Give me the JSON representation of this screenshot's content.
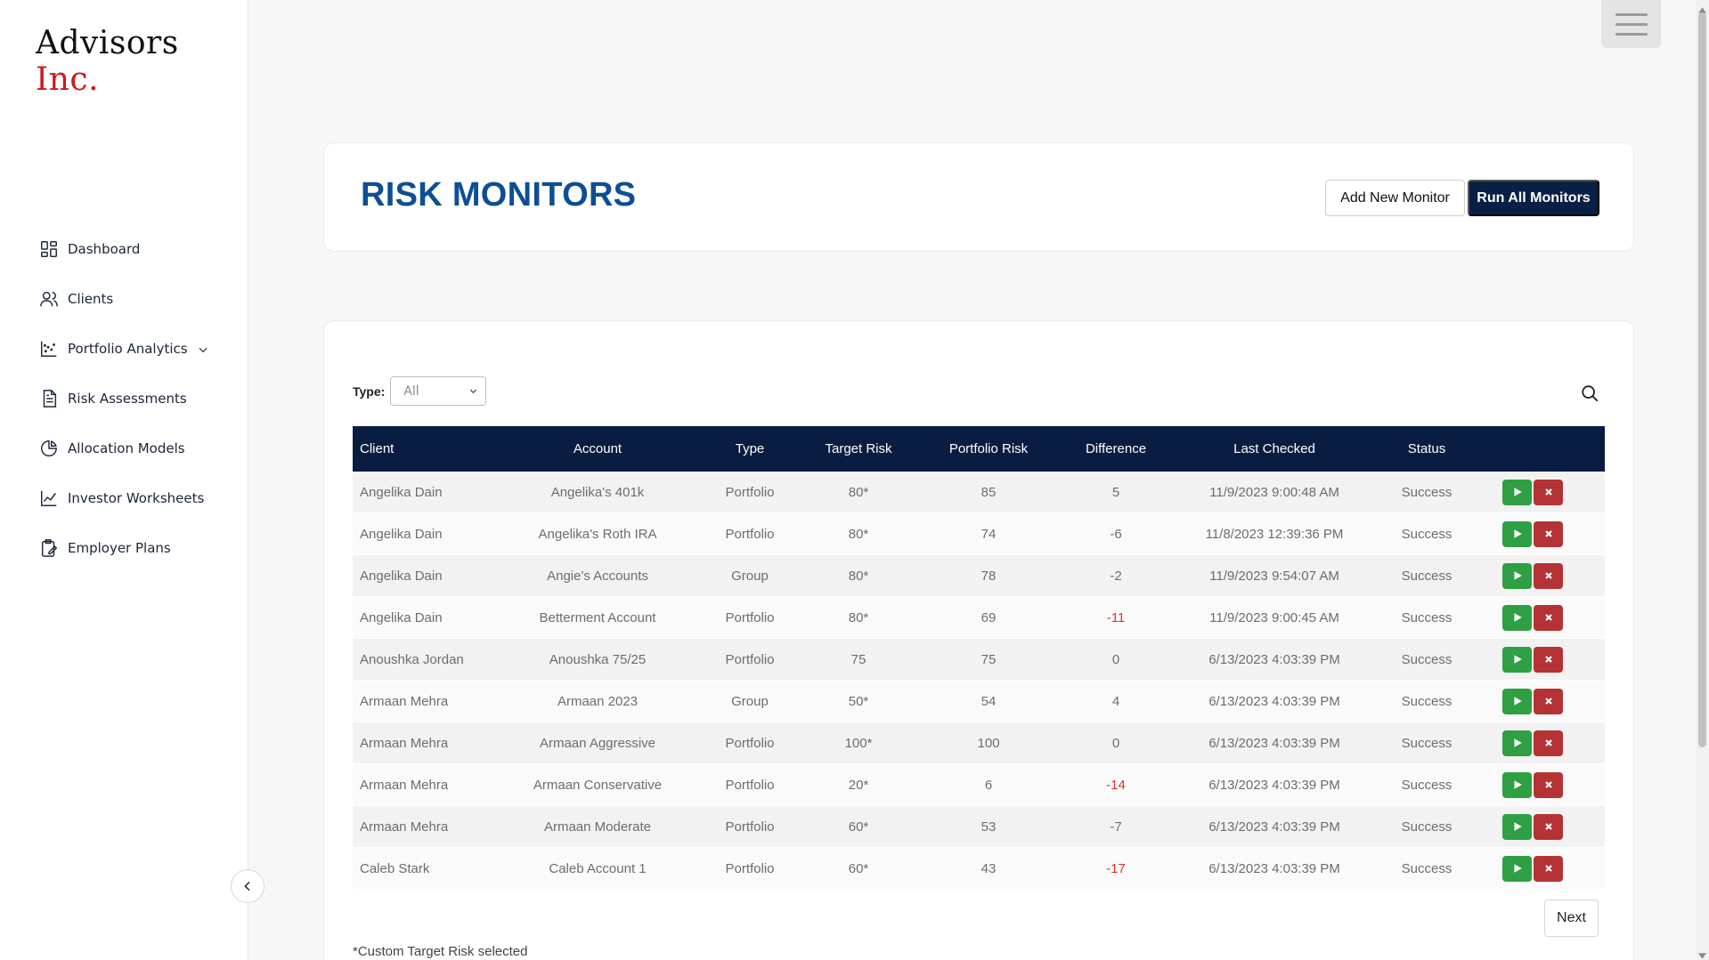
{
  "brand": {
    "name": "Advisors",
    "accent": "Inc."
  },
  "sidebar": {
    "items": [
      {
        "label": "Dashboard",
        "icon": "dashboard-icon"
      },
      {
        "label": "Clients",
        "icon": "users-icon"
      },
      {
        "label": "Portfolio Analytics",
        "icon": "scatter-chart-icon",
        "has_submenu": true
      },
      {
        "label": "Risk Assessments",
        "icon": "document-icon"
      },
      {
        "label": "Allocation Models",
        "icon": "pie-chart-icon"
      },
      {
        "label": "Investor Worksheets",
        "icon": "line-chart-icon"
      },
      {
        "label": "Employer Plans",
        "icon": "clipboard-edit-icon"
      }
    ]
  },
  "header": {
    "title": "RISK MONITORS",
    "add_label": "Add New Monitor",
    "run_label": "Run All Monitors"
  },
  "filter": {
    "label": "Type:",
    "selected": "All"
  },
  "table": {
    "columns": [
      "Client",
      "Account",
      "Type",
      "Target Risk",
      "Portfolio Risk",
      "Difference",
      "Last Checked",
      "Status"
    ],
    "rows": [
      {
        "client": "Angelika Dain",
        "account": "Angelika's 401k",
        "type": "Portfolio",
        "target": "80*",
        "risk": "85",
        "diff": "5",
        "diff_alert": false,
        "checked": "11/9/2023 9:00:48 AM",
        "status": "Success"
      },
      {
        "client": "Angelika Dain",
        "account": "Angelika's Roth IRA",
        "type": "Portfolio",
        "target": "80*",
        "risk": "74",
        "diff": "-6",
        "diff_alert": false,
        "checked": "11/8/2023 12:39:36 PM",
        "status": "Success"
      },
      {
        "client": "Angelika Dain",
        "account": "Angie's Accounts",
        "type": "Group",
        "target": "80*",
        "risk": "78",
        "diff": "-2",
        "diff_alert": false,
        "checked": "11/9/2023 9:54:07 AM",
        "status": "Success"
      },
      {
        "client": "Angelika Dain",
        "account": "Betterment Account",
        "type": "Portfolio",
        "target": "80*",
        "risk": "69",
        "diff": "-11",
        "diff_alert": true,
        "checked": "11/9/2023 9:00:45 AM",
        "status": "Success"
      },
      {
        "client": "Anoushka Jordan",
        "account": "Anoushka 75/25",
        "type": "Portfolio",
        "target": "75",
        "risk": "75",
        "diff": "0",
        "diff_alert": false,
        "checked": "6/13/2023 4:03:39 PM",
        "status": "Success"
      },
      {
        "client": "Armaan Mehra",
        "account": "Armaan 2023",
        "type": "Group",
        "target": "50*",
        "risk": "54",
        "diff": "4",
        "diff_alert": false,
        "checked": "6/13/2023 4:03:39 PM",
        "status": "Success"
      },
      {
        "client": "Armaan Mehra",
        "account": "Armaan Aggressive",
        "type": "Portfolio",
        "target": "100*",
        "risk": "100",
        "diff": "0",
        "diff_alert": false,
        "checked": "6/13/2023 4:03:39 PM",
        "status": "Success"
      },
      {
        "client": "Armaan Mehra",
        "account": "Armaan Conservative",
        "type": "Portfolio",
        "target": "20*",
        "risk": "6",
        "diff": "-14",
        "diff_alert": true,
        "checked": "6/13/2023 4:03:39 PM",
        "status": "Success"
      },
      {
        "client": "Armaan Mehra",
        "account": "Armaan Moderate",
        "type": "Portfolio",
        "target": "60*",
        "risk": "53",
        "diff": "-7",
        "diff_alert": false,
        "checked": "6/13/2023 4:03:39 PM",
        "status": "Success"
      },
      {
        "client": "Caleb Stark",
        "account": "Caleb Account 1",
        "type": "Portfolio",
        "target": "60*",
        "risk": "43",
        "diff": "-17",
        "diff_alert": true,
        "checked": "6/13/2023 4:03:39 PM",
        "status": "Success"
      }
    ]
  },
  "pagination": {
    "next_label": "Next"
  },
  "footnote": "*Custom Target Risk selected",
  "colors": {
    "title": "#0d4f94",
    "header_bg": "#091d42",
    "run_button": "#2ea043",
    "delete_button": "#b53234",
    "alert_text": "#e0342f",
    "brand_accent": "#d0181c"
  }
}
